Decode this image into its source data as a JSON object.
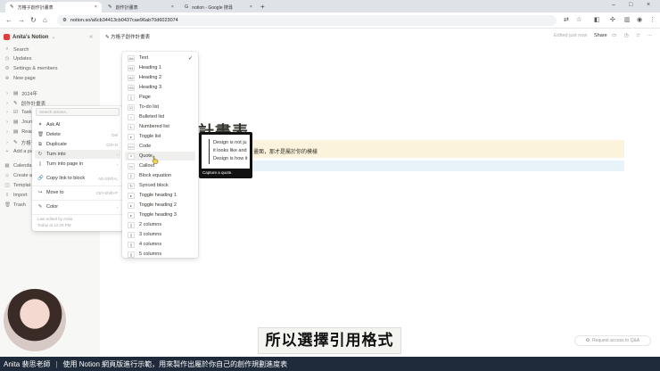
{
  "browser": {
    "tabs": [
      {
        "label": "方格子創作計畫表",
        "active": true
      },
      {
        "label": "創作計畫表",
        "active": false
      },
      {
        "label": "notion - Google 搜尋",
        "active": false
      }
    ],
    "url": "notion.so/a6cb34413cb0437cae96ab70d6023074"
  },
  "sidebar": {
    "workspace": "Anita's Notion",
    "items": [
      {
        "label": "Search",
        "icon": "search-icon"
      },
      {
        "label": "Updates",
        "icon": "clock-icon"
      },
      {
        "label": "Settings & members",
        "icon": "gear-icon"
      },
      {
        "label": "New page",
        "icon": "plus-icon"
      },
      {
        "label": "2024年",
        "icon": "page-icon"
      },
      {
        "label": "創作計畫表",
        "icon": "page-icon"
      },
      {
        "label": "Task U",
        "icon": "page-icon"
      },
      {
        "label": "Journa",
        "icon": "page-icon"
      },
      {
        "label": "Readin",
        "icon": "page-icon"
      },
      {
        "label": "方格子",
        "icon": "page-icon"
      },
      {
        "label": "Add a pa",
        "icon": "plus-icon"
      },
      {
        "label": "Calenda",
        "icon": "calendar-icon"
      },
      {
        "label": "Create a",
        "icon": "people-icon"
      },
      {
        "label": "Templat",
        "icon": "template-icon"
      },
      {
        "label": "Import",
        "icon": "import-icon"
      },
      {
        "label": "Trash",
        "icon": "trash-icon"
      }
    ]
  },
  "page": {
    "breadcrumb": "方格子創作計畫表",
    "edited": "Edited just now",
    "share": "Share",
    "title": "計畫表",
    "callout": "畫面，那才是屬於你的模樣"
  },
  "context_menu": {
    "search_placeholder": "Search actions...",
    "items": [
      {
        "label": "Ask AI",
        "shortcut": "",
        "icon": "sparkle-icon"
      },
      {
        "label": "Delete",
        "shortcut": "Del",
        "icon": "trash-icon"
      },
      {
        "label": "Duplicate",
        "shortcut": "Ctrl+D",
        "icon": "copy-icon"
      },
      {
        "label": "Turn into",
        "shortcut": "›",
        "icon": "turn-icon",
        "highlight": true
      },
      {
        "label": "Turn into page in",
        "shortcut": "›",
        "icon": "page-icon"
      },
      {
        "label": "Copy link to block",
        "shortcut": "Alt+Shift+L",
        "icon": "link-icon"
      },
      {
        "label": "Move to",
        "shortcut": "Ctrl+Shift+P",
        "icon": "move-icon"
      },
      {
        "label": "Color",
        "shortcut": "›",
        "icon": "color-icon"
      }
    ],
    "footer1": "Last edited by Anita",
    "footer2": "Today at 12:29 PM"
  },
  "turn_into": {
    "items": [
      {
        "label": "Text",
        "icon": "Aa",
        "checked": true
      },
      {
        "label": "Heading 1",
        "icon": "H1"
      },
      {
        "label": "Heading 2",
        "icon": "H2"
      },
      {
        "label": "Heading 3",
        "icon": "H3"
      },
      {
        "label": "Page",
        "icon": "▯"
      },
      {
        "label": "To-do list",
        "icon": "☑"
      },
      {
        "label": "Bulleted list",
        "icon": "•"
      },
      {
        "label": "Numbered list",
        "icon": "1."
      },
      {
        "label": "Toggle list",
        "icon": "▸"
      },
      {
        "label": "Code",
        "icon": "</>"
      },
      {
        "label": "Quote",
        "icon": "❝",
        "highlight": true
      },
      {
        "label": "Callout",
        "icon": "▭"
      },
      {
        "label": "Block equation",
        "icon": "Σ"
      },
      {
        "label": "Synced block",
        "icon": "↻"
      },
      {
        "label": "Toggle heading 1",
        "icon": "▸"
      },
      {
        "label": "Toggle heading 2",
        "icon": "▸"
      },
      {
        "label": "Toggle heading 3",
        "icon": "▸"
      },
      {
        "label": "2 columns",
        "icon": "∥"
      },
      {
        "label": "3 columns",
        "icon": "∥"
      },
      {
        "label": "4 columns",
        "icon": "∥"
      },
      {
        "label": "5 columns",
        "icon": "∥"
      }
    ]
  },
  "preview": {
    "lines": [
      "Design is not ju",
      "it looks like and",
      "Design is how it"
    ],
    "caption": "Capture a quote."
  },
  "video": {
    "subtitle": "所以選擇引用格式",
    "qa_button": "Request access to Q&A",
    "footer_name": "Anita 裴思老師",
    "footer_desc": "使用 Notion 網頁版進行示範，用來製作出屬於你自己的創作規劃進度表"
  },
  "colors": {
    "callout_bg": "#fbf3db",
    "blue_bar": "#e7f3f8",
    "footer_bg": "#1f2a3a"
  }
}
